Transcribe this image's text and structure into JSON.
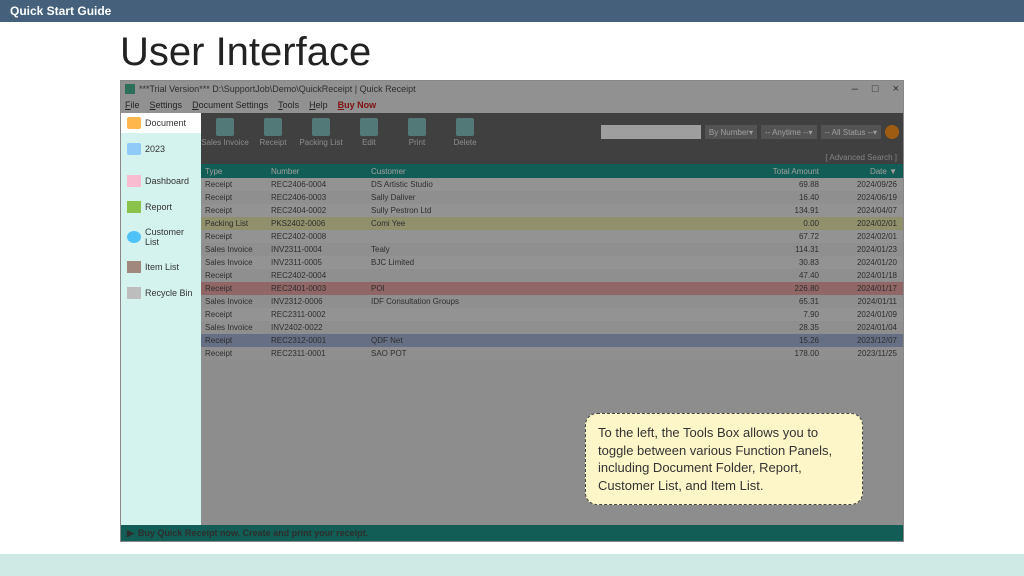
{
  "slide": {
    "header": "Quick Start Guide",
    "title": "User Interface"
  },
  "window": {
    "title": "***Trial Version*** D:\\SupportJob\\Demo\\QuickReceipt | Quick Receipt",
    "min": "–",
    "max": "□",
    "close": "×"
  },
  "menu": {
    "file": "File",
    "settings": "Settings",
    "docset": "Document Settings",
    "tools": "Tools",
    "help": "Help",
    "buy": "Buy Now"
  },
  "sidebar": {
    "document": "Document",
    "year": "2023",
    "dashboard": "Dashboard",
    "report": "Report",
    "customer": "Customer List",
    "item": "Item List",
    "recycle": "Recycle Bin"
  },
  "toolbar": {
    "salesinv": "Sales Invoice",
    "receipt": "Receipt",
    "packing": "Packing List",
    "edit": "Edit",
    "print": "Print",
    "delete": "Delete",
    "bynum": "By Number",
    "anytime": "-- Anytime --",
    "allstat": "-- All Status --",
    "adv": "[ Advanced Search ]"
  },
  "columns": {
    "type": "Type",
    "number": "Number",
    "customer": "Customer",
    "amount": "Total Amount",
    "date": "Date ▼"
  },
  "rows": [
    {
      "cls": "",
      "type": "Receipt",
      "num": "REC2406-0004",
      "cust": "DS Artistic Studio",
      "amt": "69.88",
      "date": "2024/09/26"
    },
    {
      "cls": "",
      "type": "Receipt",
      "num": "REC2406-0003",
      "cust": "Sally Daliver",
      "amt": "16.40",
      "date": "2024/06/19"
    },
    {
      "cls": "",
      "type": "Receipt",
      "num": "REC2404-0002",
      "cust": "Sully Pestron Ltd",
      "amt": "134.91",
      "date": "2024/04/07"
    },
    {
      "cls": "yellow",
      "type": "Packing List",
      "num": "PKS2402-0006",
      "cust": "Comi Yee",
      "amt": "0.00",
      "date": "2024/02/01"
    },
    {
      "cls": "",
      "type": "Receipt",
      "num": "REC2402-0008",
      "cust": "",
      "amt": "67.72",
      "date": "2024/02/01"
    },
    {
      "cls": "",
      "type": "Sales Invoice",
      "num": "INV2311-0004",
      "cust": "Tealy",
      "amt": "114.31",
      "date": "2024/01/23"
    },
    {
      "cls": "",
      "type": "Sales Invoice",
      "num": "INV2311-0005",
      "cust": "BJC Limited",
      "amt": "30.83",
      "date": "2024/01/20"
    },
    {
      "cls": "",
      "type": "Receipt",
      "num": "REC2402-0004",
      "cust": "",
      "amt": "47.40",
      "date": "2024/01/18"
    },
    {
      "cls": "red",
      "type": "Receipt",
      "num": "REC2401-0003",
      "cust": "POI",
      "amt": "226.80",
      "date": "2024/01/17"
    },
    {
      "cls": "",
      "type": "Sales Invoice",
      "num": "INV2312-0006",
      "cust": "IDF Consultation Groups",
      "amt": "65.31",
      "date": "2024/01/11"
    },
    {
      "cls": "",
      "type": "Receipt",
      "num": "REC2311-0002",
      "cust": "",
      "amt": "7.90",
      "date": "2024/01/09"
    },
    {
      "cls": "",
      "type": "Sales Invoice",
      "num": "INV2402-0022",
      "cust": "",
      "amt": "28.35",
      "date": "2024/01/04"
    },
    {
      "cls": "sel",
      "type": "Receipt",
      "num": "REC2312-0001",
      "cust": "QDF Net",
      "amt": "15.26",
      "date": "2023/12/07"
    },
    {
      "cls": "",
      "type": "Receipt",
      "num": "REC2311-0001",
      "cust": "SAO POT",
      "amt": "178.00",
      "date": "2023/11/25"
    }
  ],
  "footer": "Buy Quick Receipt now. Create and print your receipt.",
  "callout": "To the left, the Tools Box allows you to toggle between various Function Panels, including Document Folder, Report, Customer List, and Item List."
}
